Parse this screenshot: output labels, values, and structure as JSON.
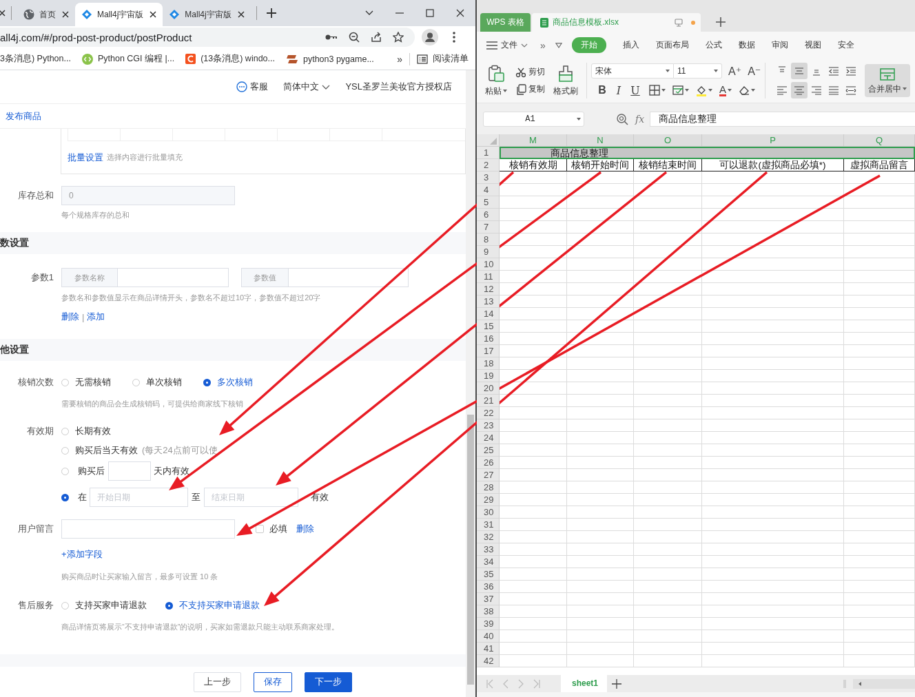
{
  "browser": {
    "tabs": [
      {
        "title": "首页",
        "kind": "globe",
        "selected": false
      },
      {
        "title": "Mall4j宇宙版",
        "kind": "diamond",
        "selected": true
      },
      {
        "title": "Mall4j宇宙版",
        "kind": "diamond",
        "selected": false
      }
    ],
    "address": "all4j.com/#/prod-post-product/postProduct",
    "bookmarks": [
      {
        "title": "3条消息) Python...",
        "kind": "plain"
      },
      {
        "title": "Python CGI 编程 |...",
        "kind": "code"
      },
      {
        "title": "(13条消息) windo...",
        "kind": "square"
      },
      {
        "title": "python3 pygame...",
        "kind": "bars"
      }
    ],
    "bookmarks_more": "»",
    "reading_list": "阅读清单"
  },
  "page": {
    "header": {
      "service": "客服",
      "language": "简体中文",
      "store": "YSL圣罗兰美妆官方授权店"
    },
    "breadcrumb": "发布商品",
    "batch": {
      "link": "批量设置",
      "hint": "选择内容进行批量填充"
    },
    "stock": {
      "label": "库存总和",
      "value": "0",
      "hint": "每个规格库存的总和"
    },
    "params": {
      "title": "数设置",
      "label": "参数1",
      "name_prepend": "参数名称",
      "value_prepend": "参数值",
      "hint": "参数名和参数值显示在商品详情开头，参数名不超过10字，参数值不超过20字",
      "links": [
        "删除",
        "添加"
      ],
      "separator": "|"
    },
    "other": {
      "title": "他设置",
      "writeoff": {
        "label": "核销次数",
        "options": [
          {
            "label": "无需核销",
            "selected": false
          },
          {
            "label": "单次核销",
            "selected": false
          },
          {
            "label": "多次核销",
            "selected": true
          }
        ],
        "hint": "需要核销的商品会生成核销码，可提供给商家线下核销"
      },
      "validity": {
        "label": "有效期",
        "options": [
          {
            "kind": "plain",
            "label": "长期有效",
            "selected": false
          },
          {
            "kind": "note",
            "label": "购买后当天有效",
            "note": "(每天24点前可以使",
            "selected": false
          },
          {
            "kind": "days",
            "label": "购买后",
            "suffix": "天内有效",
            "selected": false
          },
          {
            "kind": "range",
            "label": "在",
            "start_placeholder": "开始日期",
            "to": "至",
            "end_placeholder": "结束日期",
            "suffix": "有效",
            "selected": true
          }
        ]
      },
      "message": {
        "label": "用户留言",
        "required_label": "必填",
        "required": false,
        "delete": "删除",
        "add_field": "+添加字段",
        "hint": "购买商品时让买家输入留言，最多可设置 10 条"
      },
      "after_sales": {
        "label": "售后服务",
        "options": [
          {
            "label": "支持买家申请退款",
            "selected": false
          },
          {
            "label": "不支持买家申请退款",
            "selected": true
          }
        ],
        "hint": "商品详情页将展示“不支持申请退款”的说明，买家如需退款只能主动联系商家处理。"
      }
    },
    "footer_buttons": [
      {
        "label": "上一步",
        "kind": "default"
      },
      {
        "label": "保存",
        "kind": "outline"
      },
      {
        "label": "下一步",
        "kind": "primary"
      }
    ]
  },
  "wps": {
    "app_tab": "WPS 表格",
    "file_tab": "商品信息模板.xlsx",
    "menu_file": "文件",
    "menu_more": "»",
    "menu": [
      {
        "label": "开始",
        "selected": true
      },
      {
        "label": "插入",
        "selected": false
      },
      {
        "label": "页面布局",
        "selected": false
      },
      {
        "label": "公式",
        "selected": false
      },
      {
        "label": "数据",
        "selected": false
      },
      {
        "label": "审阅",
        "selected": false
      },
      {
        "label": "视图",
        "selected": false
      },
      {
        "label": "安全",
        "selected": false
      }
    ],
    "ribbon": {
      "paste": "粘贴",
      "cut": "剪切",
      "copy": "复制",
      "painter": "格式刷",
      "font_name": "宋体",
      "font_size": "11",
      "size_buttons": [
        "A⁺",
        "A⁻"
      ],
      "style_buttons": [
        {
          "kind": "bold",
          "label": "B"
        },
        {
          "kind": "italic",
          "label": "I"
        },
        {
          "kind": "underline",
          "label": "U"
        }
      ],
      "font_color_button": "A",
      "align_buttons": [
        {
          "kind": "top",
          "selected": false
        },
        {
          "kind": "middle",
          "selected": true
        },
        {
          "kind": "bottom",
          "selected": false
        },
        {
          "kind": "outdent",
          "selected": false
        },
        {
          "kind": "indent",
          "selected": false
        },
        {
          "kind": "left",
          "selected": false
        },
        {
          "kind": "center",
          "selected": true
        },
        {
          "kind": "right",
          "selected": false
        },
        {
          "kind": "justify",
          "selected": false
        },
        {
          "kind": "distributed",
          "selected": false
        }
      ],
      "merge": "合并居中"
    },
    "name_box": "A1",
    "fx": "fx",
    "formula": "商品信息整理",
    "columns": [
      {
        "label": "M",
        "selected": true
      },
      {
        "label": "N",
        "selected": true
      },
      {
        "label": "O",
        "selected": true
      },
      {
        "label": "P",
        "selected": true
      },
      {
        "label": "Q",
        "selected": true
      }
    ],
    "rows": [
      {
        "number": "1",
        "kind": "title",
        "title": "商品信息整理"
      },
      {
        "number": "2",
        "kind": "header",
        "cells": [
          "核销有效期",
          "核销开始时间",
          "核销结束时间",
          "可以退款(虚拟商品必填*)",
          "虚拟商品留言"
        ]
      },
      {
        "number": "3",
        "kind": "empty"
      },
      {
        "number": "4",
        "kind": "empty"
      },
      {
        "number": "5",
        "kind": "empty"
      },
      {
        "number": "6",
        "kind": "empty"
      },
      {
        "number": "7",
        "kind": "empty"
      },
      {
        "number": "8",
        "kind": "empty"
      },
      {
        "number": "9",
        "kind": "empty"
      },
      {
        "number": "10",
        "kind": "empty"
      },
      {
        "number": "11",
        "kind": "empty"
      },
      {
        "number": "12",
        "kind": "empty"
      },
      {
        "number": "13",
        "kind": "empty"
      },
      {
        "number": "14",
        "kind": "empty"
      },
      {
        "number": "15",
        "kind": "empty"
      },
      {
        "number": "16",
        "kind": "empty"
      },
      {
        "number": "17",
        "kind": "empty"
      },
      {
        "number": "18",
        "kind": "empty"
      },
      {
        "number": "19",
        "kind": "empty"
      },
      {
        "number": "20",
        "kind": "empty"
      },
      {
        "number": "21",
        "kind": "empty"
      },
      {
        "number": "22",
        "kind": "empty"
      },
      {
        "number": "23",
        "kind": "empty"
      },
      {
        "number": "24",
        "kind": "empty"
      },
      {
        "number": "25",
        "kind": "empty"
      },
      {
        "number": "26",
        "kind": "empty"
      },
      {
        "number": "27",
        "kind": "empty"
      },
      {
        "number": "28",
        "kind": "empty"
      },
      {
        "number": "29",
        "kind": "empty"
      },
      {
        "number": "30",
        "kind": "empty"
      },
      {
        "number": "31",
        "kind": "empty"
      },
      {
        "number": "32",
        "kind": "empty"
      },
      {
        "number": "33",
        "kind": "empty"
      },
      {
        "number": "34",
        "kind": "empty"
      },
      {
        "number": "35",
        "kind": "empty"
      },
      {
        "number": "36",
        "kind": "empty"
      },
      {
        "number": "37",
        "kind": "empty"
      },
      {
        "number": "38",
        "kind": "empty"
      },
      {
        "number": "39",
        "kind": "empty"
      },
      {
        "number": "40",
        "kind": "empty"
      },
      {
        "number": "41",
        "kind": "empty"
      },
      {
        "number": "42",
        "kind": "empty"
      }
    ],
    "sheet_tab": "sheet1"
  }
}
